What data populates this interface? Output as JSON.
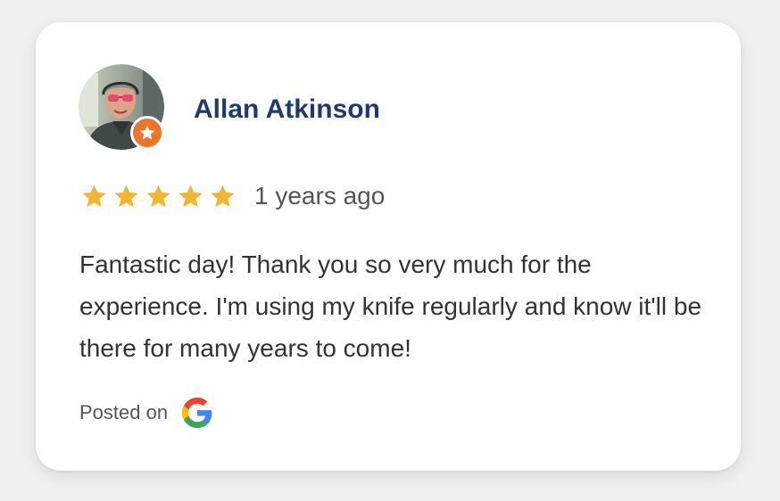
{
  "review": {
    "reviewer_name": "Allan Atkinson",
    "avatar_icon": "reviewer-photo",
    "badge_icon": "local-guide-star-icon",
    "badge_color": "#e8762b",
    "rating": 5,
    "rating_max": 5,
    "star_color": "#f2b534",
    "time_ago": "1 years ago",
    "text": "Fantastic day! Thank you so very much for the experience. I'm using my knife regularly and know it'll be there for many years to come!",
    "posted_on_label": "Posted on",
    "platform_icon": "google-icon"
  },
  "colors": {
    "name": "#1f3a6d",
    "body_text": "#333333",
    "muted_text": "#555555",
    "card_bg": "#ffffff",
    "page_bg": "#f0f0f0"
  }
}
